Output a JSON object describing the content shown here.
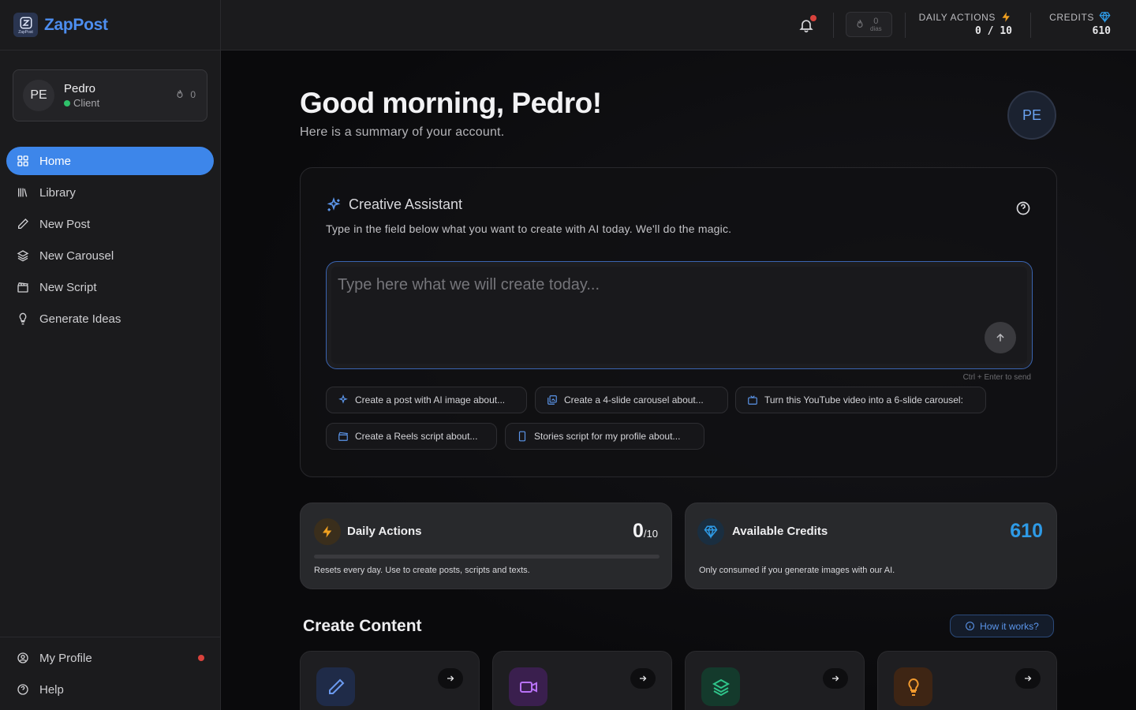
{
  "brand": {
    "name": "ZapPost",
    "logo_caption": "ZapPost"
  },
  "user": {
    "initials": "PE",
    "name": "Pedro",
    "role": "Client",
    "streak": "0"
  },
  "nav": {
    "items": [
      {
        "label": "Home",
        "icon": "grid-icon",
        "active": true
      },
      {
        "label": "Library",
        "icon": "library-icon"
      },
      {
        "label": "New Post",
        "icon": "pencil-icon"
      },
      {
        "label": "New Carousel",
        "icon": "layers-icon"
      },
      {
        "label": "New Script",
        "icon": "clapperboard-icon"
      },
      {
        "label": "Generate Ideas",
        "icon": "lightbulb-icon"
      }
    ],
    "bottom": [
      {
        "label": "My Profile",
        "icon": "user-circle-icon"
      },
      {
        "label": "Help",
        "icon": "help-circle-icon"
      }
    ]
  },
  "topbar": {
    "streak_value": "0",
    "streak_label": "dias",
    "daily_actions_label": "DAILY ACTIONS",
    "daily_actions_value": "0 / 10",
    "credits_label": "CREDITS",
    "credits_value": "610"
  },
  "greeting": {
    "title": "Good morning, Pedro!",
    "subtitle": "Here is a summary of your account.",
    "avatar": "PE"
  },
  "assistant": {
    "title": "Creative Assistant",
    "description": "Type in the field below what you want to create with AI today. We'll do the magic.",
    "placeholder": "Type here what we will create today...",
    "value": "",
    "hint": "Ctrl + Enter to send",
    "chips": [
      {
        "label": "Create a post with AI image about...",
        "icon": "sparkles-icon"
      },
      {
        "label": "Create a 4-slide carousel about...",
        "icon": "images-icon"
      },
      {
        "label": "Turn this YouTube video into a 6-slide carousel:",
        "icon": "tv-icon"
      },
      {
        "label": "Create a Reels script about...",
        "icon": "clapperboard-icon"
      },
      {
        "label": "Stories script for my profile about...",
        "icon": "smartphone-icon"
      }
    ]
  },
  "stats": {
    "daily": {
      "label": "Daily Actions",
      "value": "0",
      "max": "/10",
      "progress": 0,
      "description": "Resets every day. Use to create posts, scripts and texts."
    },
    "credits": {
      "label": "Available Credits",
      "value": "610",
      "description": "Only consumed if you generate images with our AI."
    }
  },
  "create": {
    "title": "Create Content",
    "how_label": "How it works?",
    "cards": [
      {
        "icon": "pencil-icon",
        "color": "#3b6fd8"
      },
      {
        "icon": "video-icon",
        "color": "#a855f7"
      },
      {
        "icon": "layers-icon",
        "color": "#22b573"
      },
      {
        "icon": "lightbulb-icon",
        "color": "#f08c1a"
      }
    ]
  },
  "colors": {
    "accent": "#3d86ea",
    "credits": "#2e9ae6",
    "daily": "#f0a020"
  }
}
